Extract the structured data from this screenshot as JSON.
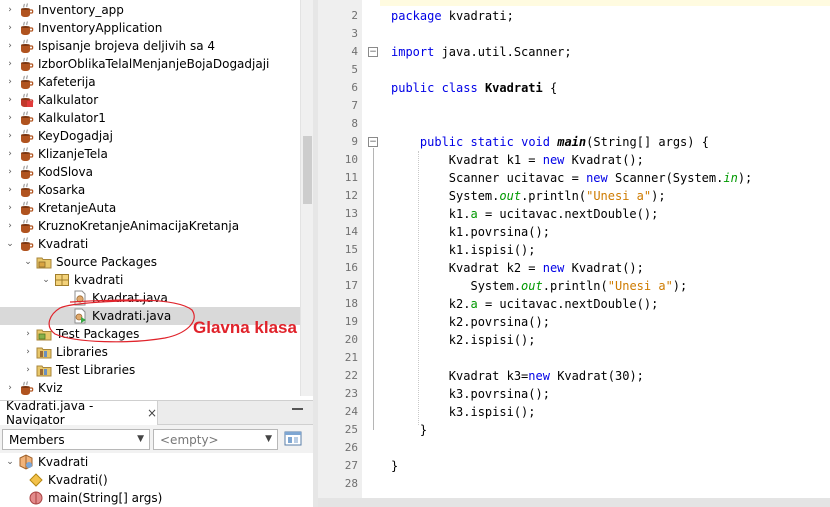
{
  "project_tree": {
    "items": [
      {
        "label": "Inventory_app",
        "indent": 0,
        "expander": "closed",
        "icon": "java-project-icon"
      },
      {
        "label": "InventoryApplication",
        "indent": 0,
        "expander": "closed",
        "icon": "java-project-icon"
      },
      {
        "label": "Ispisanje brojeva deljivih sa 4",
        "indent": 0,
        "expander": "closed",
        "icon": "java-project-icon"
      },
      {
        "label": "IzborOblikaTelalMenjanjeBojaDogadjaji",
        "indent": 0,
        "expander": "closed",
        "icon": "java-project-icon"
      },
      {
        "label": "Kafeterija",
        "indent": 0,
        "expander": "closed",
        "icon": "java-project-icon"
      },
      {
        "label": "Kalkulator",
        "indent": 0,
        "expander": "closed",
        "icon": "java-project-main-icon"
      },
      {
        "label": "Kalkulator1",
        "indent": 0,
        "expander": "closed",
        "icon": "java-project-icon"
      },
      {
        "label": "KeyDogadjaj",
        "indent": 0,
        "expander": "closed",
        "icon": "java-project-icon"
      },
      {
        "label": "KlizanjeTela",
        "indent": 0,
        "expander": "closed",
        "icon": "java-project-icon"
      },
      {
        "label": "KodSlova",
        "indent": 0,
        "expander": "closed",
        "icon": "java-project-icon"
      },
      {
        "label": "Kosarka",
        "indent": 0,
        "expander": "closed",
        "icon": "java-project-icon"
      },
      {
        "label": "KretanjeAuta",
        "indent": 0,
        "expander": "closed",
        "icon": "java-project-icon"
      },
      {
        "label": "KruznoKretanjeAnimacijaKretanja",
        "indent": 0,
        "expander": "closed",
        "icon": "java-project-icon"
      },
      {
        "label": "Kvadrati",
        "indent": 0,
        "expander": "open",
        "icon": "java-project-icon"
      },
      {
        "label": "Source Packages",
        "indent": 1,
        "expander": "open",
        "icon": "source-packages-icon"
      },
      {
        "label": "kvadrati",
        "indent": 2,
        "expander": "open",
        "icon": "package-icon"
      },
      {
        "label": "Kvadrat.java",
        "indent": 3,
        "expander": "none",
        "icon": "java-file-icon"
      },
      {
        "label": "Kvadrati.java",
        "indent": 3,
        "expander": "none",
        "icon": "java-main-file-icon",
        "selected": true
      },
      {
        "label": "Test Packages",
        "indent": 1,
        "expander": "closed",
        "icon": "test-packages-icon"
      },
      {
        "label": "Libraries",
        "indent": 1,
        "expander": "closed",
        "icon": "libraries-icon"
      },
      {
        "label": "Test Libraries",
        "indent": 1,
        "expander": "closed",
        "icon": "libraries-icon"
      },
      {
        "label": "Kviz",
        "indent": 0,
        "expander": "closed",
        "icon": "java-project-icon"
      }
    ]
  },
  "annotation": {
    "text": "Glavna klasa",
    "color": "#e0232b"
  },
  "navigator": {
    "tab_title": "Kvadrati.java - Navigator",
    "close_glyph": "×",
    "filter_combo": "Members",
    "scope_combo": "<empty>",
    "items": [
      {
        "label": "Kvadrati",
        "icon": "class-icon",
        "indent": 0,
        "expander": "open"
      },
      {
        "label": "Kvadrati()",
        "icon": "constructor-icon",
        "indent": 1
      },
      {
        "label": "main(String[] args)",
        "icon": "method-icon",
        "indent": 1
      }
    ]
  },
  "editor": {
    "colors": {
      "keyword": "#0000e6",
      "string": "#ce7b00",
      "field": "#009900"
    },
    "lines": [
      {
        "n": "2",
        "tokens": [
          {
            "t": "package",
            "c": "kw"
          },
          {
            "t": " kvadrati;"
          }
        ]
      },
      {
        "n": "3",
        "tokens": []
      },
      {
        "n": "4",
        "tokens": [
          {
            "t": "import",
            "c": "kw"
          },
          {
            "t": " java.util.Scanner;"
          }
        ],
        "fold": "minus"
      },
      {
        "n": "5",
        "tokens": []
      },
      {
        "n": "6",
        "tokens": [
          {
            "t": "public",
            "c": "kw"
          },
          {
            "t": " "
          },
          {
            "t": "class",
            "c": "kw"
          },
          {
            "t": " "
          },
          {
            "t": "Kvadrati",
            "c": "bold"
          },
          {
            "t": " {"
          }
        ]
      },
      {
        "n": "7",
        "tokens": []
      },
      {
        "n": "8",
        "tokens": []
      },
      {
        "n": "9",
        "tokens": [
          {
            "t": "    "
          },
          {
            "t": "public",
            "c": "kw"
          },
          {
            "t": " "
          },
          {
            "t": "static",
            "c": "kw"
          },
          {
            "t": " "
          },
          {
            "t": "void",
            "c": "kw"
          },
          {
            "t": " "
          },
          {
            "t": "main",
            "c": "bi"
          },
          {
            "t": "(String[] args) {"
          }
        ],
        "fold": "minus"
      },
      {
        "n": "10",
        "tokens": [
          {
            "t": "        Kvadrat k1 = "
          },
          {
            "t": "new",
            "c": "kw"
          },
          {
            "t": " Kvadrat();"
          }
        ]
      },
      {
        "n": "11",
        "tokens": [
          {
            "t": "        Scanner ucitavac = "
          },
          {
            "t": "new",
            "c": "kw"
          },
          {
            "t": " Scanner(System."
          },
          {
            "t": "in",
            "c": "sfld"
          },
          {
            "t": ");"
          }
        ]
      },
      {
        "n": "12",
        "tokens": [
          {
            "t": "        System."
          },
          {
            "t": "out",
            "c": "sfld"
          },
          {
            "t": ".println("
          },
          {
            "t": "\"Unesi a\"",
            "c": "str"
          },
          {
            "t": ");"
          }
        ]
      },
      {
        "n": "13",
        "tokens": [
          {
            "t": "        k1."
          },
          {
            "t": "a",
            "c": "fld"
          },
          {
            "t": " = ucitavac.nextDouble();"
          }
        ]
      },
      {
        "n": "14",
        "tokens": [
          {
            "t": "        k1.povrsina();"
          }
        ]
      },
      {
        "n": "15",
        "tokens": [
          {
            "t": "        k1.ispisi();"
          }
        ]
      },
      {
        "n": "16",
        "tokens": [
          {
            "t": "        Kvadrat k2 = "
          },
          {
            "t": "new",
            "c": "kw"
          },
          {
            "t": " Kvadrat();"
          }
        ]
      },
      {
        "n": "17",
        "tokens": [
          {
            "t": "           System."
          },
          {
            "t": "out",
            "c": "sfld"
          },
          {
            "t": ".println("
          },
          {
            "t": "\"Unesi a\"",
            "c": "str"
          },
          {
            "t": ");"
          }
        ]
      },
      {
        "n": "18",
        "tokens": [
          {
            "t": "        k2."
          },
          {
            "t": "a",
            "c": "fld"
          },
          {
            "t": " = ucitavac.nextDouble();"
          }
        ]
      },
      {
        "n": "19",
        "tokens": [
          {
            "t": "        k2.povrsina();"
          }
        ]
      },
      {
        "n": "20",
        "tokens": [
          {
            "t": "        k2.ispisi();"
          }
        ]
      },
      {
        "n": "21",
        "tokens": []
      },
      {
        "n": "22",
        "tokens": [
          {
            "t": "        Kvadrat k3="
          },
          {
            "t": "new",
            "c": "kw"
          },
          {
            "t": " Kvadrat(30);"
          }
        ]
      },
      {
        "n": "23",
        "tokens": [
          {
            "t": "        k3.povrsina();"
          }
        ]
      },
      {
        "n": "24",
        "tokens": [
          {
            "t": "        k3.ispisi();"
          }
        ]
      },
      {
        "n": "25",
        "tokens": [
          {
            "t": "    }"
          }
        ]
      },
      {
        "n": "26",
        "tokens": []
      },
      {
        "n": "27",
        "tokens": [
          {
            "t": "}"
          }
        ]
      },
      {
        "n": "28",
        "tokens": []
      }
    ]
  }
}
